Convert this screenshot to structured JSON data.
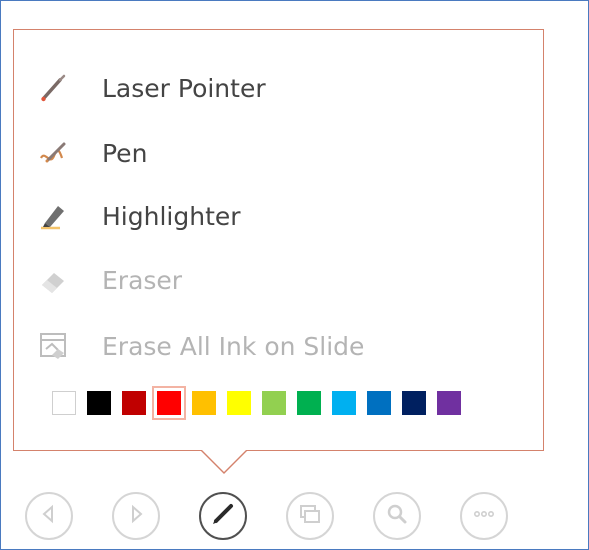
{
  "menu": {
    "items": [
      {
        "label": "Laser Pointer",
        "icon": "laser-pointer-icon",
        "enabled": true
      },
      {
        "label": "Pen",
        "icon": "pen-icon",
        "enabled": true
      },
      {
        "label": "Highlighter",
        "icon": "highlighter-icon",
        "enabled": true
      },
      {
        "label": "Eraser",
        "icon": "eraser-icon",
        "enabled": false
      },
      {
        "label": "Erase All Ink on Slide",
        "icon": "erase-all-ink-icon",
        "enabled": false
      }
    ]
  },
  "colors": {
    "swatches": [
      "#ffffff",
      "#000000",
      "#c00000",
      "#ff0000",
      "#ffc000",
      "#ffff00",
      "#92d050",
      "#00b050",
      "#00b0f0",
      "#0070c0",
      "#002060",
      "#7030a0"
    ],
    "selected": "#ff0000"
  },
  "toolbar": {
    "buttons": [
      "previous-slide-icon",
      "next-slide-icon",
      "pen-tool-icon",
      "slide-sorter-icon",
      "zoom-icon",
      "more-options-icon"
    ],
    "active": "pen-tool-icon"
  }
}
